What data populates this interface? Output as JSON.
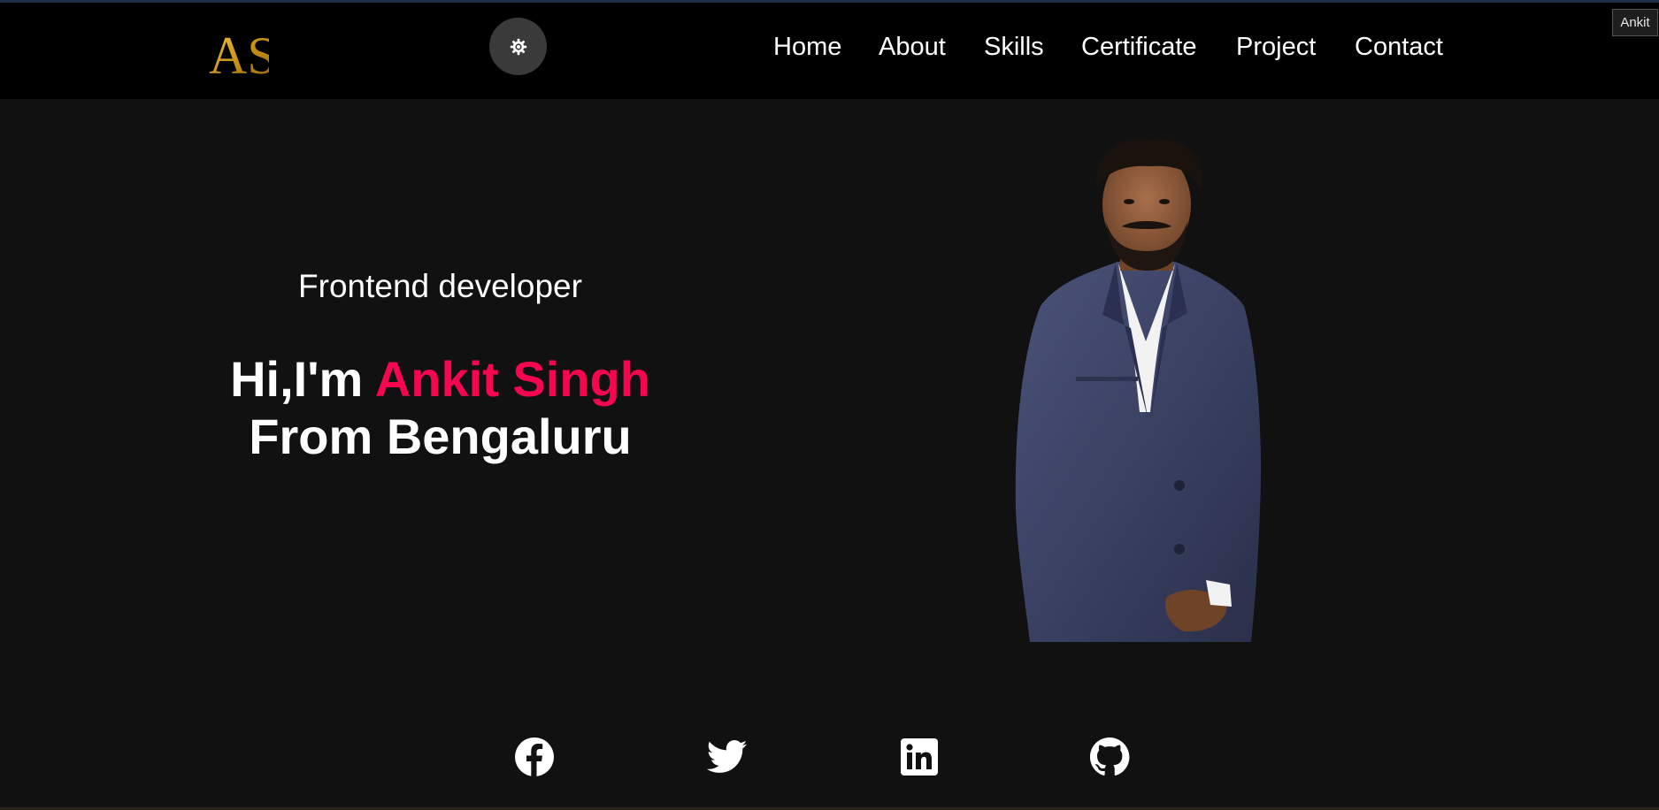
{
  "header": {
    "logo_text": "AS",
    "theme_toggle_icon": "gear-icon",
    "nav": [
      "Home",
      "About",
      "Skills",
      "Certificate",
      "Project",
      "Contact"
    ]
  },
  "tooltip": "Ankit",
  "hero": {
    "role": "Frontend developer",
    "greeting": "Hi,I'm",
    "name": "Ankit Singh",
    "location": "From Bengaluru",
    "accent_color": "#f5064f",
    "portrait_icon": "portrait-photo"
  },
  "social": [
    {
      "icon": "facebook-icon"
    },
    {
      "icon": "twitter-icon"
    },
    {
      "icon": "linkedin-icon"
    },
    {
      "icon": "github-icon"
    }
  ],
  "colors": {
    "header_bg": "#000000",
    "page_bg": "#111111",
    "logo_gold": "#d4a017"
  }
}
